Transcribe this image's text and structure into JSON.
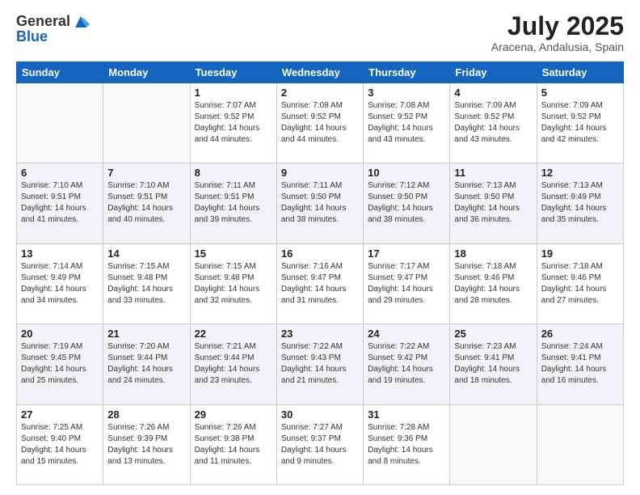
{
  "logo": {
    "general": "General",
    "blue": "Blue"
  },
  "header": {
    "month": "July 2025",
    "location": "Aracena, Andalusia, Spain"
  },
  "days_of_week": [
    "Sunday",
    "Monday",
    "Tuesday",
    "Wednesday",
    "Thursday",
    "Friday",
    "Saturday"
  ],
  "weeks": [
    [
      {
        "day": "",
        "info": ""
      },
      {
        "day": "",
        "info": ""
      },
      {
        "day": "1",
        "info": "Sunrise: 7:07 AM\nSunset: 9:52 PM\nDaylight: 14 hours and 44 minutes."
      },
      {
        "day": "2",
        "info": "Sunrise: 7:08 AM\nSunset: 9:52 PM\nDaylight: 14 hours and 44 minutes."
      },
      {
        "day": "3",
        "info": "Sunrise: 7:08 AM\nSunset: 9:52 PM\nDaylight: 14 hours and 43 minutes."
      },
      {
        "day": "4",
        "info": "Sunrise: 7:09 AM\nSunset: 9:52 PM\nDaylight: 14 hours and 43 minutes."
      },
      {
        "day": "5",
        "info": "Sunrise: 7:09 AM\nSunset: 9:52 PM\nDaylight: 14 hours and 42 minutes."
      }
    ],
    [
      {
        "day": "6",
        "info": "Sunrise: 7:10 AM\nSunset: 9:51 PM\nDaylight: 14 hours and 41 minutes."
      },
      {
        "day": "7",
        "info": "Sunrise: 7:10 AM\nSunset: 9:51 PM\nDaylight: 14 hours and 40 minutes."
      },
      {
        "day": "8",
        "info": "Sunrise: 7:11 AM\nSunset: 9:51 PM\nDaylight: 14 hours and 39 minutes."
      },
      {
        "day": "9",
        "info": "Sunrise: 7:11 AM\nSunset: 9:50 PM\nDaylight: 14 hours and 38 minutes."
      },
      {
        "day": "10",
        "info": "Sunrise: 7:12 AM\nSunset: 9:50 PM\nDaylight: 14 hours and 38 minutes."
      },
      {
        "day": "11",
        "info": "Sunrise: 7:13 AM\nSunset: 9:50 PM\nDaylight: 14 hours and 36 minutes."
      },
      {
        "day": "12",
        "info": "Sunrise: 7:13 AM\nSunset: 9:49 PM\nDaylight: 14 hours and 35 minutes."
      }
    ],
    [
      {
        "day": "13",
        "info": "Sunrise: 7:14 AM\nSunset: 9:49 PM\nDaylight: 14 hours and 34 minutes."
      },
      {
        "day": "14",
        "info": "Sunrise: 7:15 AM\nSunset: 9:48 PM\nDaylight: 14 hours and 33 minutes."
      },
      {
        "day": "15",
        "info": "Sunrise: 7:15 AM\nSunset: 9:48 PM\nDaylight: 14 hours and 32 minutes."
      },
      {
        "day": "16",
        "info": "Sunrise: 7:16 AM\nSunset: 9:47 PM\nDaylight: 14 hours and 31 minutes."
      },
      {
        "day": "17",
        "info": "Sunrise: 7:17 AM\nSunset: 9:47 PM\nDaylight: 14 hours and 29 minutes."
      },
      {
        "day": "18",
        "info": "Sunrise: 7:18 AM\nSunset: 9:46 PM\nDaylight: 14 hours and 28 minutes."
      },
      {
        "day": "19",
        "info": "Sunrise: 7:18 AM\nSunset: 9:46 PM\nDaylight: 14 hours and 27 minutes."
      }
    ],
    [
      {
        "day": "20",
        "info": "Sunrise: 7:19 AM\nSunset: 9:45 PM\nDaylight: 14 hours and 25 minutes."
      },
      {
        "day": "21",
        "info": "Sunrise: 7:20 AM\nSunset: 9:44 PM\nDaylight: 14 hours and 24 minutes."
      },
      {
        "day": "22",
        "info": "Sunrise: 7:21 AM\nSunset: 9:44 PM\nDaylight: 14 hours and 23 minutes."
      },
      {
        "day": "23",
        "info": "Sunrise: 7:22 AM\nSunset: 9:43 PM\nDaylight: 14 hours and 21 minutes."
      },
      {
        "day": "24",
        "info": "Sunrise: 7:22 AM\nSunset: 9:42 PM\nDaylight: 14 hours and 19 minutes."
      },
      {
        "day": "25",
        "info": "Sunrise: 7:23 AM\nSunset: 9:41 PM\nDaylight: 14 hours and 18 minutes."
      },
      {
        "day": "26",
        "info": "Sunrise: 7:24 AM\nSunset: 9:41 PM\nDaylight: 14 hours and 16 minutes."
      }
    ],
    [
      {
        "day": "27",
        "info": "Sunrise: 7:25 AM\nSunset: 9:40 PM\nDaylight: 14 hours and 15 minutes."
      },
      {
        "day": "28",
        "info": "Sunrise: 7:26 AM\nSunset: 9:39 PM\nDaylight: 14 hours and 13 minutes."
      },
      {
        "day": "29",
        "info": "Sunrise: 7:26 AM\nSunset: 9:38 PM\nDaylight: 14 hours and 11 minutes."
      },
      {
        "day": "30",
        "info": "Sunrise: 7:27 AM\nSunset: 9:37 PM\nDaylight: 14 hours and 9 minutes."
      },
      {
        "day": "31",
        "info": "Sunrise: 7:28 AM\nSunset: 9:36 PM\nDaylight: 14 hours and 8 minutes."
      },
      {
        "day": "",
        "info": ""
      },
      {
        "day": "",
        "info": ""
      }
    ]
  ]
}
